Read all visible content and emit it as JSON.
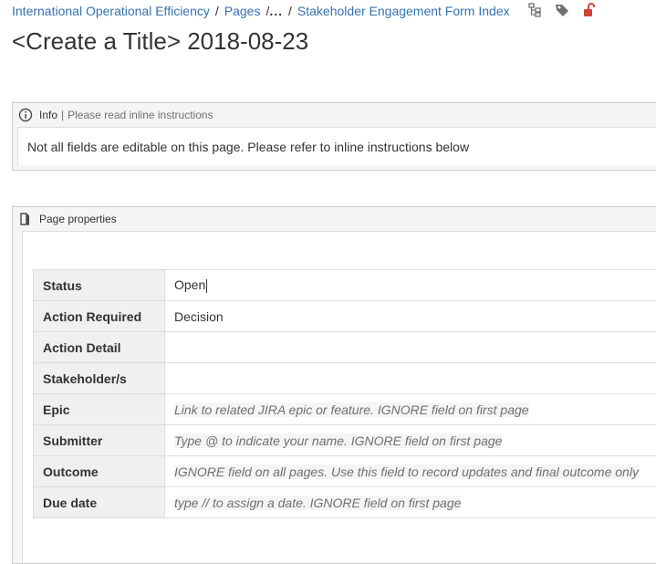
{
  "breadcrumb": {
    "space": "International Operational Efficiency",
    "pages": "Pages",
    "ellipsis": "...",
    "parent": "Stakeholder Engagement Form Index",
    "separator": "/"
  },
  "title": "<Create a Title> 2018-08-23",
  "info_panel": {
    "label": "Info",
    "divider": "|",
    "hint": "Please read inline instructions",
    "message": "Not all fields are editable on this page. Please refer to inline instructions below"
  },
  "properties_panel": {
    "label": "Page properties",
    "rows": [
      {
        "key": "Status",
        "value": "Open",
        "placeholder": ""
      },
      {
        "key": "Action Required",
        "value": "Decision",
        "placeholder": ""
      },
      {
        "key": "Action Detail",
        "value": "",
        "placeholder": ""
      },
      {
        "key": "Stakeholder/s",
        "value": "",
        "placeholder": ""
      },
      {
        "key": "Epic",
        "value": "",
        "placeholder": "Link to related JIRA epic or feature. IGNORE field on first page"
      },
      {
        "key": "Submitter",
        "value": "",
        "placeholder": "Type @ to indicate your name. IGNORE field on first page"
      },
      {
        "key": "Outcome",
        "value": "",
        "placeholder": "IGNORE field on all pages. Use this field to record updates and final outcome only"
      },
      {
        "key": "Due date",
        "value": "",
        "placeholder": "type // to assign a date. IGNORE field on first page"
      }
    ]
  },
  "icons": {
    "tree": "page-tree-icon",
    "label": "label-tag-icon",
    "restrictions": "unlocked-padlock-icon",
    "info": "info-circle-icon",
    "properties": "page-properties-icon"
  },
  "colors": {
    "link": "#3572b0",
    "restriction": "#d04437"
  }
}
